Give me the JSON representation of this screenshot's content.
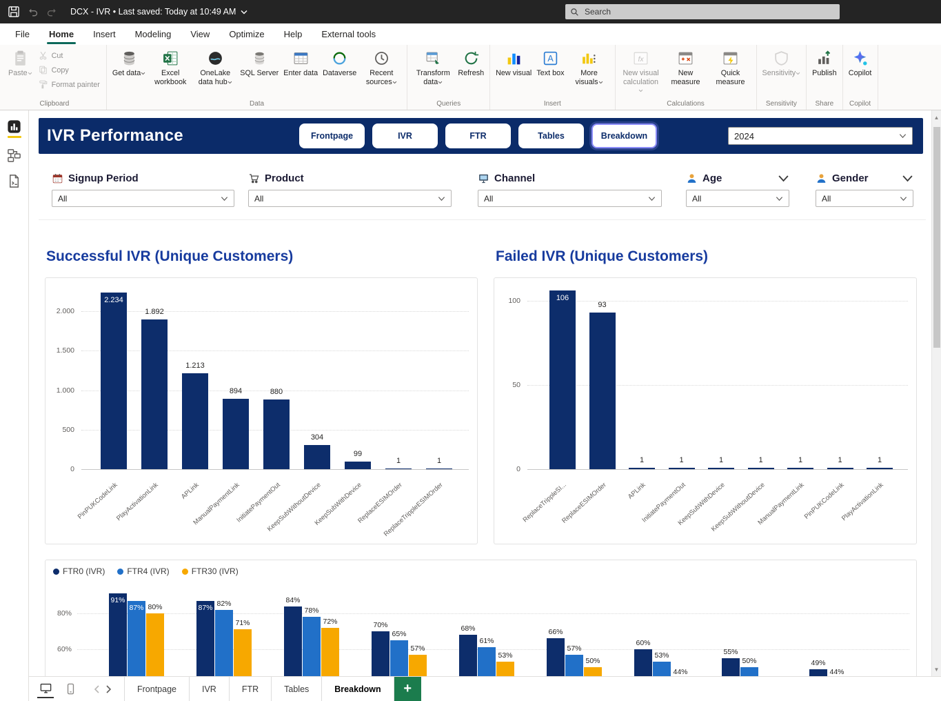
{
  "titlebar": {
    "title": "DCX - IVR • Last saved: Today at 10:49 AM",
    "search_placeholder": "Search"
  },
  "menu": {
    "items": [
      "File",
      "Home",
      "Insert",
      "Modeling",
      "View",
      "Optimize",
      "Help",
      "External tools"
    ],
    "active": "Home"
  },
  "ribbon": {
    "groups": [
      {
        "label": "Clipboard",
        "buttons": [
          {
            "label": "Paste",
            "icon": "paste-icon",
            "disabled": true,
            "caret": true
          },
          {
            "label": "Cut",
            "icon": "cut-icon",
            "disabled": true,
            "small": true
          },
          {
            "label": "Copy",
            "icon": "copy-icon",
            "disabled": true,
            "small": true
          },
          {
            "label": "Format painter",
            "icon": "format-painter-icon",
            "disabled": true,
            "small": true
          }
        ]
      },
      {
        "label": "Data",
        "buttons": [
          {
            "label": "Get data",
            "icon": "get-data-icon",
            "caret": true
          },
          {
            "label": "Excel workbook",
            "icon": "excel-icon"
          },
          {
            "label": "OneLake data hub",
            "icon": "onelake-icon",
            "caret": true
          },
          {
            "label": "SQL Server",
            "icon": "sql-server-icon"
          },
          {
            "label": "Enter data",
            "icon": "enter-data-icon"
          },
          {
            "label": "Dataverse",
            "icon": "dataverse-icon"
          },
          {
            "label": "Recent sources",
            "icon": "recent-sources-icon",
            "caret": true
          }
        ]
      },
      {
        "label": "Queries",
        "buttons": [
          {
            "label": "Transform data",
            "icon": "transform-data-icon",
            "caret": true
          },
          {
            "label": "Refresh",
            "icon": "refresh-icon"
          }
        ]
      },
      {
        "label": "Insert",
        "buttons": [
          {
            "label": "New visual",
            "icon": "new-visual-icon"
          },
          {
            "label": "Text box",
            "icon": "text-box-icon"
          },
          {
            "label": "More visuals",
            "icon": "more-visuals-icon",
            "caret": true
          }
        ]
      },
      {
        "label": "Calculations",
        "buttons": [
          {
            "label": "New visual calculation",
            "icon": "new-visual-calculation-icon",
            "caret": true,
            "disabled": true
          },
          {
            "label": "New measure",
            "icon": "new-measure-icon"
          },
          {
            "label": "Quick measure",
            "icon": "quick-measure-icon"
          }
        ]
      },
      {
        "label": "Sensitivity",
        "buttons": [
          {
            "label": "Sensitivity",
            "icon": "sensitivity-icon",
            "caret": true,
            "disabled": true
          }
        ]
      },
      {
        "label": "Share",
        "buttons": [
          {
            "label": "Publish",
            "icon": "publish-icon"
          }
        ]
      },
      {
        "label": "Copilot",
        "buttons": [
          {
            "label": "Copilot",
            "icon": "copilot-icon"
          }
        ]
      }
    ]
  },
  "side_rail": {
    "items": [
      {
        "name": "report-view",
        "icon": "report-view-icon",
        "active": true
      },
      {
        "name": "model-view",
        "icon": "model-view-icon",
        "active": false
      },
      {
        "name": "dax-query-view",
        "icon": "dax-query-view-icon",
        "active": false
      }
    ]
  },
  "report": {
    "title": "IVR Performance",
    "nav_tabs": [
      {
        "label": "Frontpage",
        "active": false
      },
      {
        "label": "IVR",
        "active": false
      },
      {
        "label": "FTR",
        "active": false
      },
      {
        "label": "Tables",
        "active": false
      },
      {
        "label": "Breakdown",
        "active": true
      }
    ],
    "year_selector": {
      "value": "2024"
    },
    "filters": [
      {
        "label": "Signup Period",
        "value": "All",
        "icon": "calendar-icon",
        "expander": false
      },
      {
        "label": "Product",
        "value": "All",
        "icon": "cart-icon",
        "expander": false
      },
      {
        "label": "Channel",
        "value": "All",
        "icon": "monitor-icon",
        "expander": false
      },
      {
        "label": "Age",
        "value": "All",
        "icon": "person-icon",
        "expander": true
      },
      {
        "label": "Gender",
        "value": "All",
        "icon": "person-icon",
        "expander": true
      }
    ]
  },
  "chart_data": [
    {
      "id": "successful-ivr",
      "type": "bar",
      "title": "Successful IVR (Unique Customers)",
      "categories": [
        "PinPUKCodeLink",
        "PlayActivationLink",
        "APLink",
        "ManualPaymentLink",
        "InitiatePaymentOut",
        "KeepSubWithoutDevice",
        "KeepSubWithDevice",
        "ReplaceESIMOrder",
        "ReplaceTrippleESIMOrder"
      ],
      "values": [
        2234,
        1892,
        1213,
        894,
        880,
        304,
        99,
        1,
        1
      ],
      "value_labels": [
        "2.234",
        "1.892",
        "1.213",
        "894",
        "880",
        "304",
        "99",
        "1",
        "1"
      ],
      "y_ticks": [
        {
          "value": 0,
          "label": "0"
        },
        {
          "value": 500,
          "label": "500"
        },
        {
          "value": 1000,
          "label": "1.000"
        },
        {
          "value": 1500,
          "label": "1.500"
        },
        {
          "value": 2000,
          "label": "2.000"
        }
      ],
      "ylim": [
        0,
        2250
      ],
      "bar_color": "#0d2d6b",
      "grid": true
    },
    {
      "id": "failed-ivr",
      "type": "bar",
      "title": "Failed IVR (Unique Customers)",
      "categories": [
        "ReplaceTrippleSI...",
        "ReplaceESIMOrder",
        "APLink",
        "InitiatePaymentOut",
        "KeepSubWithDevice",
        "KeepSubWithoutDevice",
        "ManualPaymentLink",
        "PinPUKCodeLink",
        "PlayActivationLink"
      ],
      "values": [
        106,
        93,
        1,
        1,
        1,
        1,
        1,
        1,
        1
      ],
      "value_labels": [
        "106",
        "93",
        "1",
        "1",
        "1",
        "1",
        "1",
        "1",
        "1"
      ],
      "y_ticks": [
        {
          "value": 0,
          "label": "0"
        },
        {
          "value": 50,
          "label": "50"
        },
        {
          "value": 100,
          "label": "100"
        }
      ],
      "ylim": [
        0,
        112
      ],
      "bar_color": "#0d2d6b",
      "grid": true
    },
    {
      "id": "ftr-by-flow",
      "type": "grouped-bar",
      "unit": "%",
      "legend_position": "top-left",
      "categories": [],
      "series": [
        {
          "name": "FTR0 (IVR)",
          "color": "#0d2d6b",
          "values": [
            91,
            87,
            84,
            70,
            68,
            66,
            60,
            55,
            49
          ]
        },
        {
          "name": "FTR4 (IVR)",
          "color": "#2170c8",
          "values": [
            87,
            82,
            78,
            65,
            61,
            57,
            53,
            50,
            44
          ]
        },
        {
          "name": "FTR30 (IVR)",
          "color": "#f7a800",
          "values": [
            80,
            71,
            72,
            57,
            53,
            50,
            44,
            null,
            null
          ]
        }
      ],
      "y_ticks": [
        {
          "value": 80,
          "label": "80%"
        },
        {
          "value": 60,
          "label": "60%"
        }
      ],
      "grid": true
    }
  ],
  "pagebar": {
    "tabs": [
      {
        "label": "Frontpage",
        "active": false
      },
      {
        "label": "IVR",
        "active": false
      },
      {
        "label": "FTR",
        "active": false
      },
      {
        "label": "Tables",
        "active": false
      },
      {
        "label": "Breakdown",
        "active": true
      }
    ],
    "new_page_label": "+"
  },
  "colors": {
    "navy": "#0d2d6b",
    "blue": "#2170c8",
    "orange": "#f7a800",
    "header_band": "#0b2b69",
    "chart_title_blue": "#173b9e",
    "active_nav_outline": "#8b8cf8",
    "menu_accent": "#0c695a",
    "new_page_green": "#1b7c4d",
    "rail_accent_yellow": "#f2c811"
  }
}
